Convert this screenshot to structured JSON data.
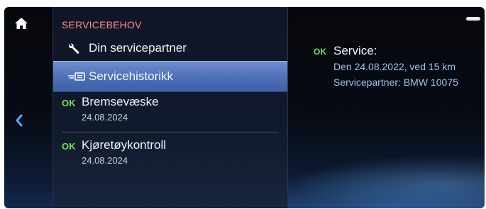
{
  "menu": {
    "section_title": "SERVICEBEHOV",
    "items": [
      {
        "label": "Din servicepartner",
        "icon": "wrench-icon"
      },
      {
        "label": "Servicehistorikk",
        "icon": "service-history-icon",
        "selected": true
      },
      {
        "label": "Bremsevæske",
        "status": "OK",
        "date": "24.08.2024"
      },
      {
        "label": "Kjøretøykontroll",
        "status": "OK",
        "date": "24.08.2024"
      }
    ]
  },
  "detail": {
    "status": "OK",
    "title": "Service:",
    "line1": "Den 24.08.2022, ved 15 km",
    "line2": "Servicepartner: BMW 10075"
  },
  "icons": {
    "home": "home-icon",
    "back": "chevron-left-icon",
    "minimize": "minimize-handle"
  },
  "colors": {
    "ok": "#76e05c",
    "section_title": "#ff8c8c",
    "selected_bg": "#5676bf",
    "detail_text": "#9ec3ee"
  }
}
